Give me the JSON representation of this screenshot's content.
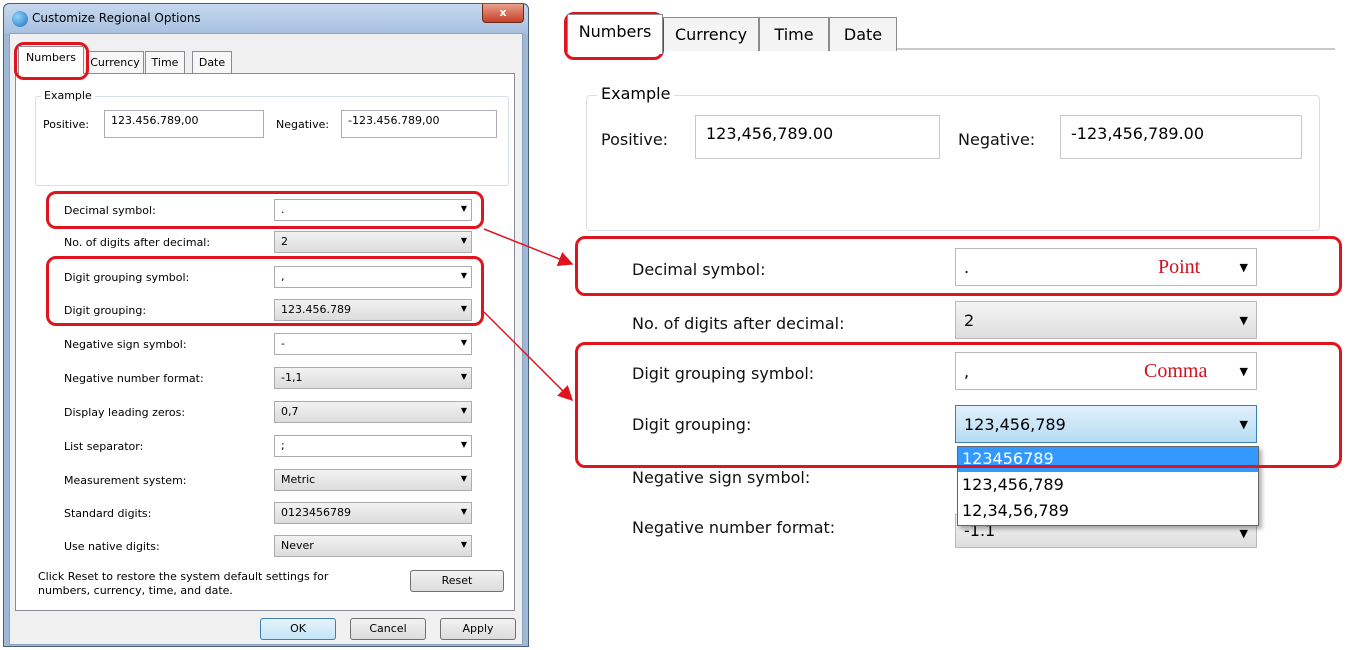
{
  "dialog": {
    "title": "Customize Regional Options",
    "close_glyph": "x",
    "tabs": [
      {
        "label": "Numbers"
      },
      {
        "label": "Currency"
      },
      {
        "label": "Time"
      },
      {
        "label": "Date"
      }
    ],
    "example": {
      "label": "Example",
      "positive_label": "Positive:",
      "positive_value": "123.456.789,00",
      "negative_label": "Negative:",
      "negative_value": "-123.456.789,00"
    },
    "rows": [
      {
        "label": "Decimal symbol:",
        "value": "."
      },
      {
        "label": "No. of digits after decimal:",
        "value": "2"
      },
      {
        "label": "Digit grouping symbol:",
        "value": ","
      },
      {
        "label": "Digit grouping:",
        "value": "123.456.789"
      },
      {
        "label": "Negative sign symbol:",
        "value": "-"
      },
      {
        "label": "Negative number format:",
        "value": "-1,1"
      },
      {
        "label": "Display leading zeros:",
        "value": "0,7"
      },
      {
        "label": "List separator:",
        "value": ";"
      },
      {
        "label": "Measurement system:",
        "value": "Metric"
      },
      {
        "label": "Standard digits:",
        "value": "0123456789"
      },
      {
        "label": "Use native digits:",
        "value": "Never"
      }
    ],
    "reset_hint": "Click Reset to restore the system default settings for numbers, currency, time, and date.",
    "reset_label": "Reset",
    "ok_label": "OK",
    "cancel_label": "Cancel",
    "apply_label": "Apply"
  },
  "zoom": {
    "tabs": [
      {
        "label": "Numbers"
      },
      {
        "label": "Currency"
      },
      {
        "label": "Time"
      },
      {
        "label": "Date"
      }
    ],
    "example": {
      "label": "Example",
      "positive_label": "Positive:",
      "positive_value": "123,456,789.00",
      "negative_label": "Negative:",
      "negative_value": "-123,456,789.00"
    },
    "rows": [
      {
        "label": "Decimal symbol:",
        "value": ".",
        "note": "Point"
      },
      {
        "label": "No. of digits after decimal:",
        "value": "2"
      },
      {
        "label": "Digit grouping symbol:",
        "value": ",",
        "note": "Comma"
      },
      {
        "label": "Digit grouping:",
        "value": "123,456,789"
      },
      {
        "label": "Negative sign symbol:"
      },
      {
        "label": "Negative number format:",
        "value": "-1.1"
      }
    ],
    "dropdown_options": [
      "123456789",
      "123,456,789",
      "12,34,56,789"
    ]
  },
  "colors": {
    "annotation": "#e0141e",
    "highlight": "#3399ff"
  }
}
